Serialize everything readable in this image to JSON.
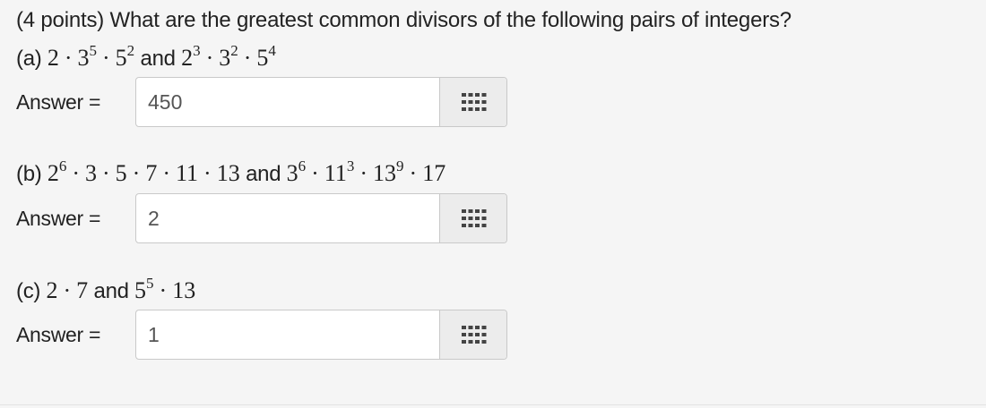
{
  "question": {
    "text": "(4 points) What are the greatest common divisors of the following pairs of integers?"
  },
  "parts": [
    {
      "label": "(a)",
      "expr1": [
        {
          "base": "2"
        },
        {
          "base": "3",
          "exp": "5"
        },
        {
          "base": "5",
          "exp": "2"
        }
      ],
      "conjunction": "and",
      "expr2": [
        {
          "base": "2",
          "exp": "3"
        },
        {
          "base": "3",
          "exp": "2"
        },
        {
          "base": "5",
          "exp": "4"
        }
      ],
      "answer_label": "Answer =",
      "answer_value": "450"
    },
    {
      "label": "(b)",
      "expr1": [
        {
          "base": "2",
          "exp": "6"
        },
        {
          "base": "3"
        },
        {
          "base": "5"
        },
        {
          "base": "7"
        },
        {
          "base": "11"
        },
        {
          "base": "13"
        }
      ],
      "conjunction": "and",
      "expr2": [
        {
          "base": "3",
          "exp": "6"
        },
        {
          "base": "11",
          "exp": "3"
        },
        {
          "base": "13",
          "exp": "9"
        },
        {
          "base": "17"
        }
      ],
      "answer_label": "Answer =",
      "answer_value": "2"
    },
    {
      "label": "(c)",
      "expr1": [
        {
          "base": "2"
        },
        {
          "base": "7"
        }
      ],
      "conjunction": "and",
      "expr2": [
        {
          "base": "5",
          "exp": "5"
        },
        {
          "base": "13"
        }
      ],
      "answer_label": "Answer =",
      "answer_value": "1"
    }
  ],
  "icons": {
    "palette": "grid-icon"
  }
}
